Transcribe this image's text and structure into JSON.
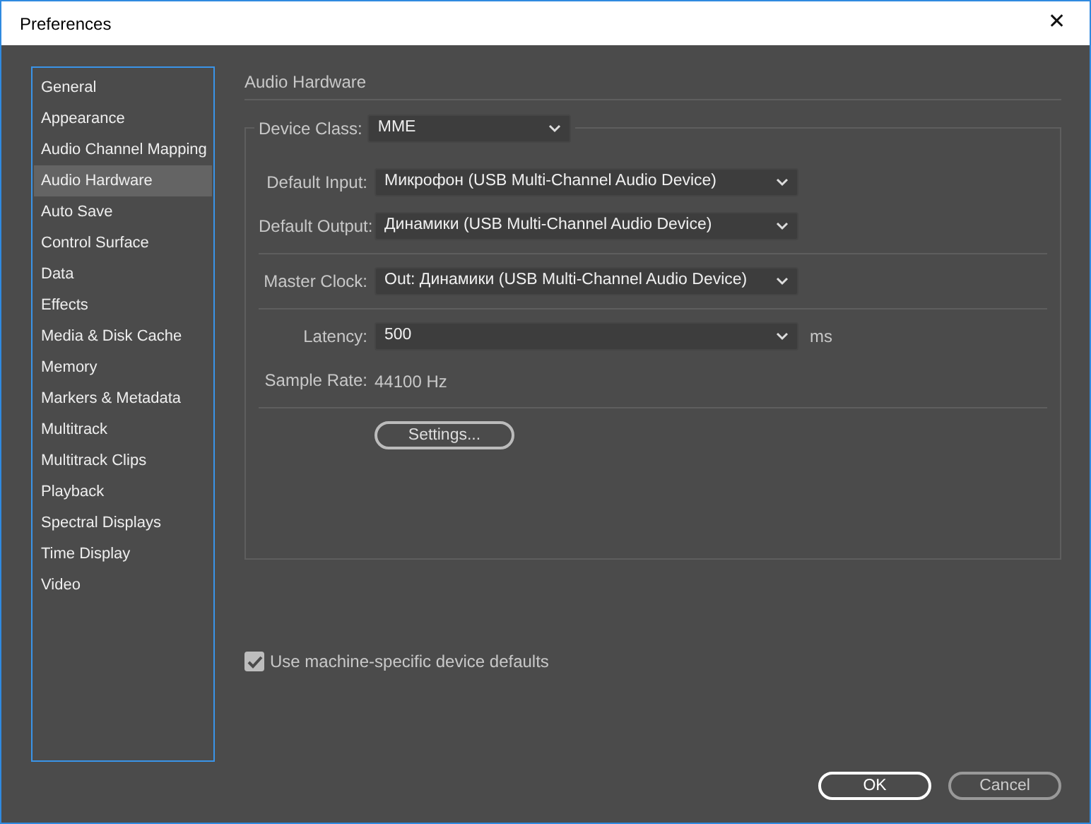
{
  "window": {
    "title": "Preferences",
    "close": "✕"
  },
  "sidebar": {
    "items": [
      {
        "label": "General",
        "selected": false
      },
      {
        "label": "Appearance",
        "selected": false
      },
      {
        "label": "Audio Channel Mapping",
        "selected": false
      },
      {
        "label": "Audio Hardware",
        "selected": true
      },
      {
        "label": "Auto Save",
        "selected": false
      },
      {
        "label": "Control Surface",
        "selected": false
      },
      {
        "label": "Data",
        "selected": false
      },
      {
        "label": "Effects",
        "selected": false
      },
      {
        "label": "Media & Disk Cache",
        "selected": false
      },
      {
        "label": "Memory",
        "selected": false
      },
      {
        "label": "Markers & Metadata",
        "selected": false
      },
      {
        "label": "Multitrack",
        "selected": false
      },
      {
        "label": "Multitrack Clips",
        "selected": false
      },
      {
        "label": "Playback",
        "selected": false
      },
      {
        "label": "Spectral Displays",
        "selected": false
      },
      {
        "label": "Time Display",
        "selected": false
      },
      {
        "label": "Video",
        "selected": false
      }
    ]
  },
  "section_title": "Audio Hardware",
  "device_class": {
    "label": "Device Class:",
    "value": "MME"
  },
  "groups": [
    [
      {
        "kind": "select",
        "label": "Default Input:",
        "value": "Микрофон (USB Multi-Channel Audio Device)"
      },
      {
        "kind": "select",
        "label": "Default Output:",
        "value": "Динамики (USB Multi-Channel Audio Device)"
      }
    ],
    [
      {
        "kind": "select",
        "label": "Master Clock:",
        "value": "Out: Динамики (USB Multi-Channel Audio Device)"
      }
    ],
    [
      {
        "kind": "select",
        "label": "Latency:",
        "value": "500",
        "unit": "ms"
      },
      {
        "kind": "readout",
        "label": "Sample Rate:",
        "value": "44100 Hz"
      }
    ],
    [
      {
        "kind": "button",
        "label": "Settings..."
      }
    ]
  ],
  "checkbox": {
    "label": "Use machine-specific device defaults",
    "checked": true
  },
  "buttons": [
    {
      "label": "OK",
      "default": true
    },
    {
      "label": "Cancel",
      "default": false
    }
  ]
}
